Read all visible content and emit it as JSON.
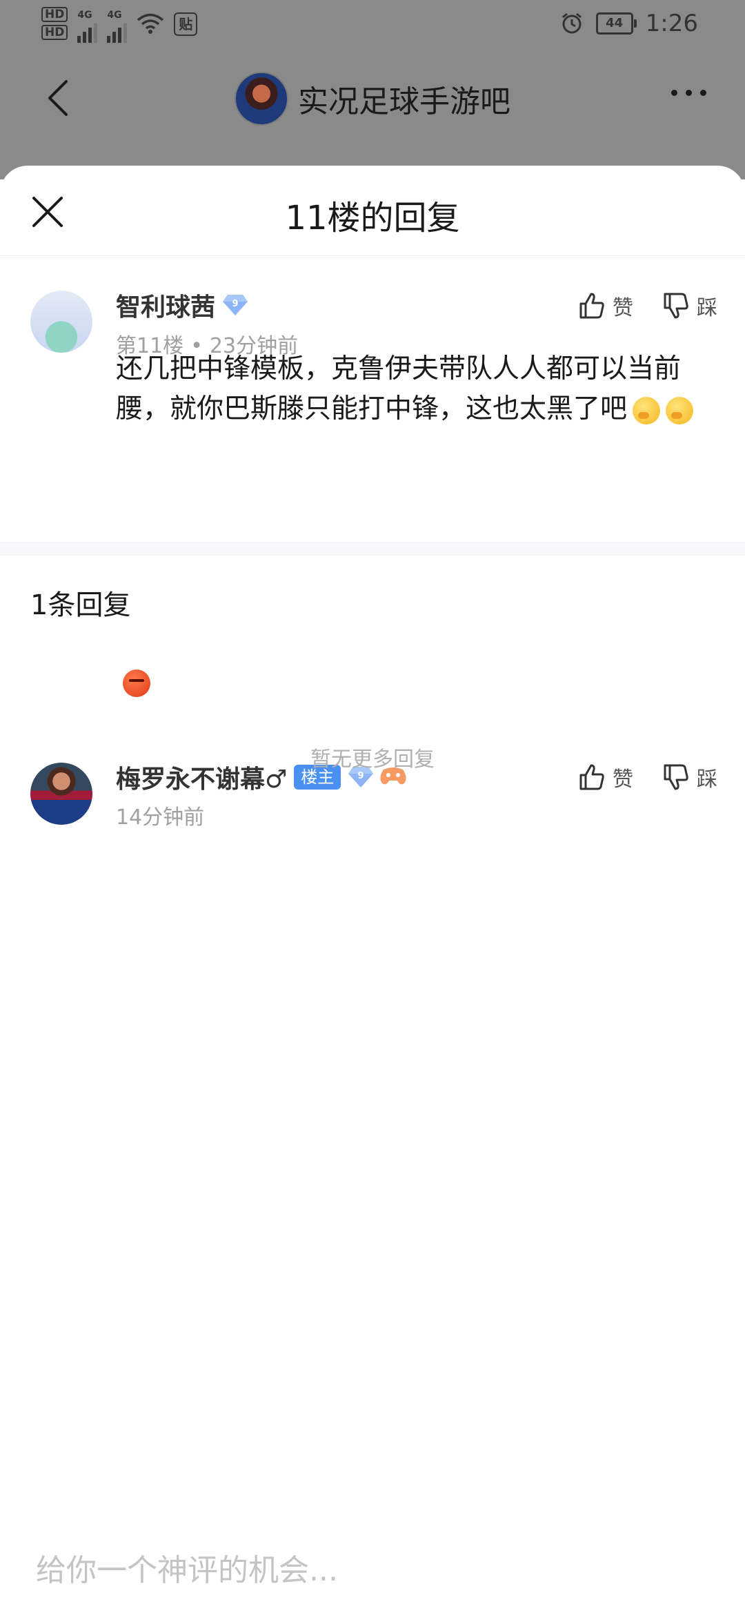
{
  "status_bar": {
    "hd1": "HD",
    "hd2": "HD",
    "sig1_label": "4G",
    "sig2_label": "4G",
    "tie_glyph": "贴",
    "battery": "44",
    "time": "1:26"
  },
  "app_bar": {
    "forum_name": "实况足球手游吧"
  },
  "sheet": {
    "title": "11楼的回复"
  },
  "main_comment": {
    "username": "智利球茜",
    "level": "9",
    "floor": "第11楼",
    "time_ago": "23分钟前",
    "text": "还几把中锋模板，克鲁伊夫带队人人都可以当前腰，就你巴斯滕只能打中锋，这也太黑了吧",
    "like_label": "赞",
    "dislike_label": "踩"
  },
  "replies_header": {
    "count_label": "1条回复"
  },
  "reply": {
    "username": "梅罗永不谢幕♂",
    "host_tag": "楼主",
    "level": "9",
    "time_ago": "14分钟前",
    "like_label": "赞",
    "dislike_label": "踩"
  },
  "no_more_label": "暂无更多回复",
  "input": {
    "placeholder": "给你一个神评的机会..."
  },
  "colors": {
    "accent_blue": "#4a90f0",
    "overlay_gray": "#8a8a8a",
    "meta_gray": "#a0a0a0"
  }
}
